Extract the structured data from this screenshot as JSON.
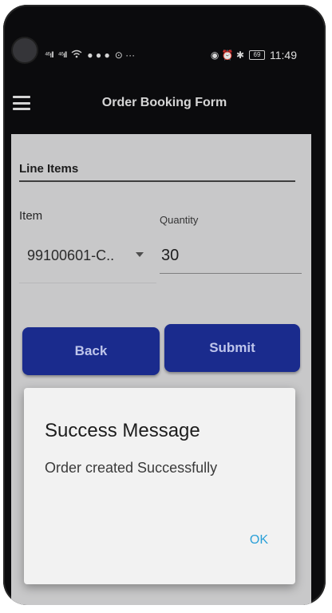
{
  "status_bar": {
    "signal_1": "⁴⁶ıll",
    "signal_2": "⁴⁶ıll",
    "wifi_icon": "wifi-icon",
    "notification_dots": "● ● ●",
    "extra": "⊙ ···",
    "right_icons": "◉ ⏰ ✱",
    "battery": "69",
    "time": "11:49"
  },
  "appbar": {
    "title": "Order Booking Form",
    "menu_icon": "hamburger-menu-icon"
  },
  "form": {
    "section_title": "Line Items",
    "item_label": "Item",
    "item_value": "99100601-C..",
    "quantity_label": "Quantity",
    "quantity_value": "30"
  },
  "buttons": {
    "back": "Back",
    "submit": "Submit"
  },
  "dialog": {
    "title": "Success Message",
    "message": "Order created Successfully",
    "ok": "OK"
  },
  "colors": {
    "primary_button": "#1d2f9a",
    "dialog_link": "#2aa0d8",
    "content_background": "#d9d9db",
    "frame": "#0d0d0f"
  }
}
